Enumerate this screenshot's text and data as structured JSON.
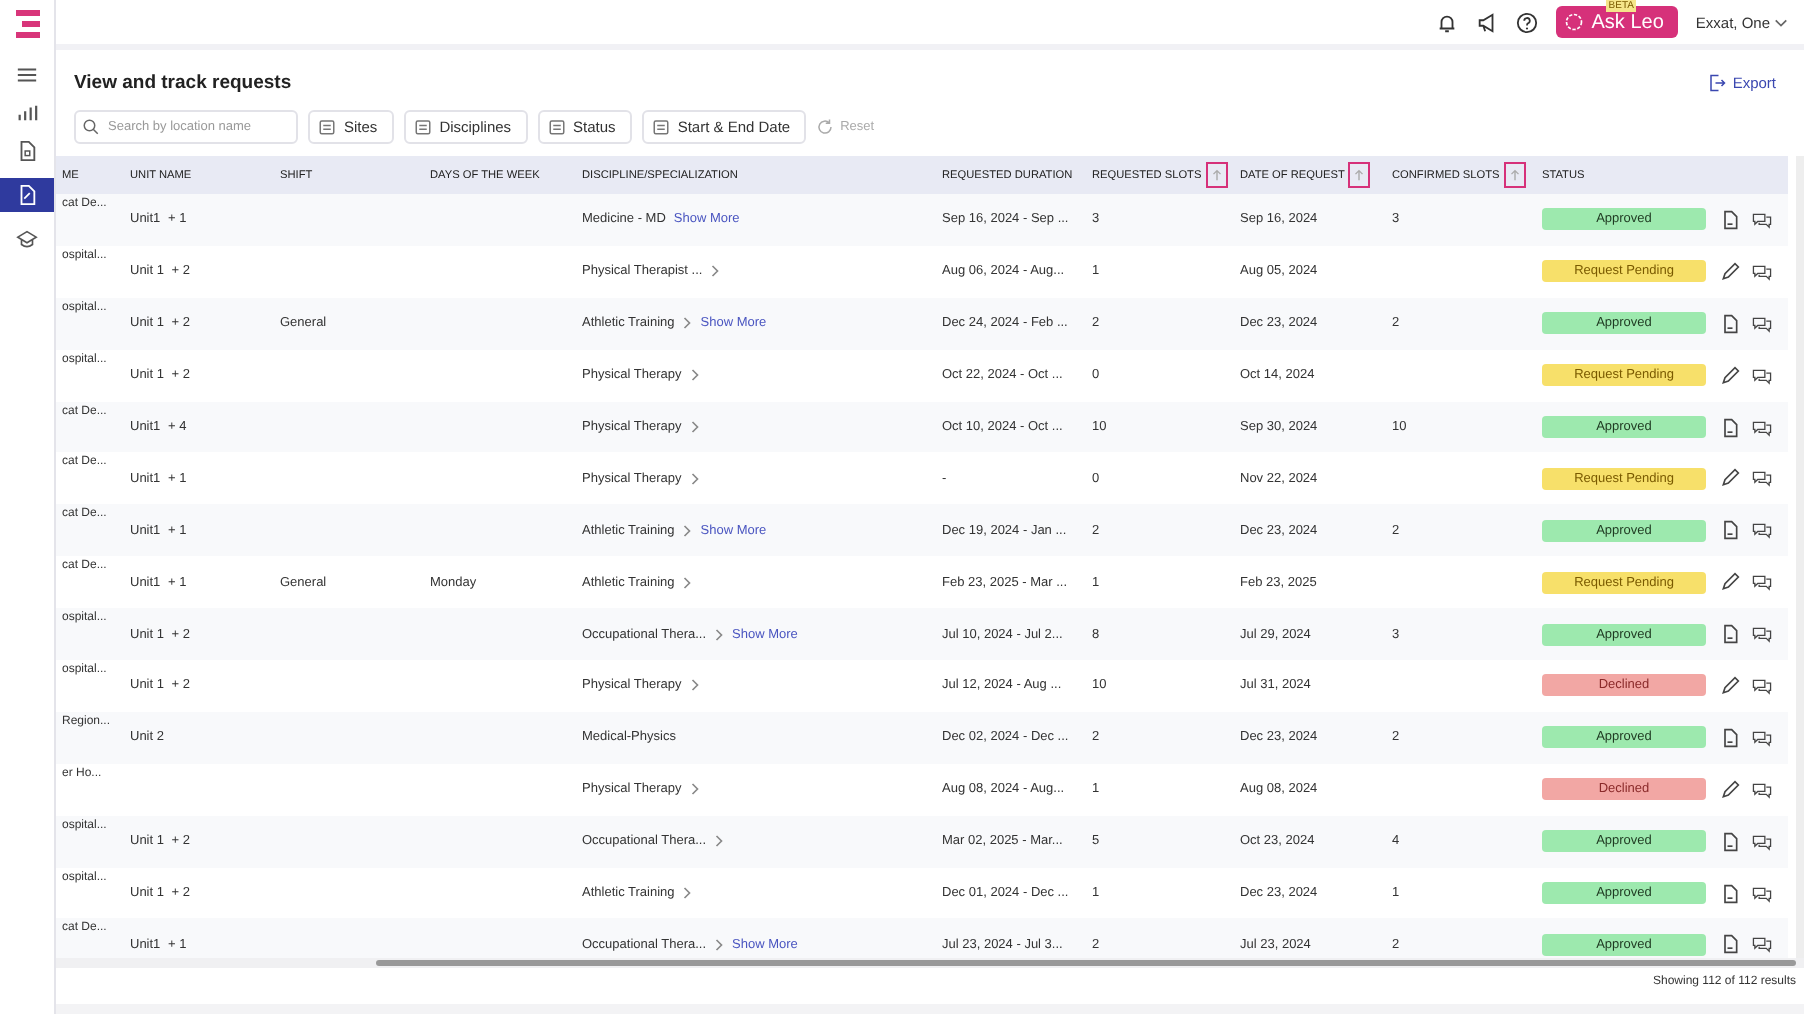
{
  "topbar": {
    "ask_button": "Ask Leo",
    "beta_badge": "BETA",
    "user": "Exxat, One"
  },
  "page": {
    "title": "View and track requests",
    "export": "Export"
  },
  "filters": {
    "search_placeholder": "Search by location name",
    "buttons": [
      "Sites",
      "Disciplines",
      "Status",
      "Start & End Date"
    ],
    "reset": "Reset"
  },
  "table": {
    "columns": [
      {
        "label": "ME",
        "sortable": false
      },
      {
        "label": "UNIT NAME",
        "sortable": false
      },
      {
        "label": "SHIFT",
        "sortable": false
      },
      {
        "label": "DAYS OF THE WEEK",
        "sortable": false
      },
      {
        "label": "DISCIPLINE/SPECIALIZATION",
        "sortable": false
      },
      {
        "label": "REQUESTED DURATION",
        "sortable": false
      },
      {
        "label": "REQUESTED SLOTS",
        "sortable": true
      },
      {
        "label": "DATE OF REQUEST",
        "sortable": true
      },
      {
        "label": "CONFIRMED SLOTS",
        "sortable": true
      },
      {
        "label": "STATUS",
        "sortable": false
      }
    ],
    "rows": [
      {
        "site": "cat De...",
        "unit": "Unit1",
        "extra": "+ 1",
        "shift": "",
        "days": "",
        "discipline": "Medicine - MD",
        "show_more": "Show More",
        "duration": "Sep 16, 2024  - Sep ...",
        "slots": "3",
        "date": "Sep 16, 2024",
        "confirmed": "3",
        "status": {
          "kind": "approved",
          "label": "Approved"
        }
      },
      {
        "site": "ospital...",
        "unit": "Unit 1",
        "extra": "+ 2",
        "shift": "",
        "days": "",
        "discipline": "Physical Therapist ...",
        "show_more": "",
        "duration": "Aug 06, 2024  - Aug...",
        "slots": "1",
        "date": "Aug 05, 2024",
        "confirmed": "",
        "status": {
          "kind": "pending",
          "label": "Request Pending"
        }
      },
      {
        "site": "ospital...",
        "unit": "Unit 1",
        "extra": "+ 2",
        "shift": "General",
        "days": "",
        "discipline": "Athletic Training",
        "show_more": "Show More",
        "duration": "Dec 24, 2024  - Feb ...",
        "slots": "2",
        "date": "Dec 23, 2024",
        "confirmed": "2",
        "status": {
          "kind": "approved",
          "label": "Approved"
        }
      },
      {
        "site": "ospital...",
        "unit": "Unit 1",
        "extra": "+ 2",
        "shift": "",
        "days": "",
        "discipline": "Physical Therapy",
        "show_more": "",
        "duration": "Oct 22, 2024  - Oct ...",
        "slots": "0",
        "date": "Oct 14, 2024",
        "confirmed": "",
        "status": {
          "kind": "pending",
          "label": "Request Pending"
        }
      },
      {
        "site": "cat De...",
        "unit": "Unit1",
        "extra": "+ 4",
        "shift": "",
        "days": "",
        "discipline": "Physical Therapy",
        "show_more": "",
        "duration": "Oct 10, 2024  - Oct ...",
        "slots": "10",
        "date": "Sep 30, 2024",
        "confirmed": "10",
        "status": {
          "kind": "approved",
          "label": "Approved"
        }
      },
      {
        "site": "cat De...",
        "unit": "Unit1",
        "extra": "+ 1",
        "shift": "",
        "days": "",
        "discipline": "Physical Therapy",
        "show_more": "",
        "duration": "-",
        "slots": "0",
        "date": "Nov 22, 2024",
        "confirmed": "",
        "status": {
          "kind": "pending",
          "label": "Request Pending"
        }
      },
      {
        "site": "cat De...",
        "unit": "Unit1",
        "extra": "+ 1",
        "shift": "",
        "days": "",
        "discipline": "Athletic Training",
        "show_more": "Show More",
        "duration": "Dec 19, 2024  - Jan ...",
        "slots": "2",
        "date": "Dec 23, 2024",
        "confirmed": "2",
        "status": {
          "kind": "approved",
          "label": "Approved"
        }
      },
      {
        "site": "cat De...",
        "unit": "Unit1",
        "extra": "+ 1",
        "shift": "General",
        "days": "Monday",
        "discipline": "Athletic Training",
        "show_more": "",
        "duration": "Feb 23, 2025  - Mar ...",
        "slots": "1",
        "date": "Feb 23, 2025",
        "confirmed": "",
        "status": {
          "kind": "pending",
          "label": "Request Pending"
        }
      },
      {
        "site": "ospital...",
        "unit": "Unit 1",
        "extra": "+ 2",
        "shift": "",
        "days": "",
        "discipline": "Occupational Thera...",
        "show_more": "Show More",
        "duration": "Jul 10, 2024  - Jul 2...",
        "slots": "8",
        "date": "Jul 29, 2024",
        "confirmed": "3",
        "status": {
          "kind": "approved",
          "label": "Approved"
        }
      },
      {
        "site": "ospital...",
        "unit": "Unit 1",
        "extra": "+ 2",
        "shift": "",
        "days": "",
        "discipline": "Physical Therapy",
        "show_more": "",
        "duration": "Jul 12, 2024  - Aug ...",
        "slots": "10",
        "date": "Jul 31, 2024",
        "confirmed": "",
        "status": {
          "kind": "declined",
          "label": "Declined"
        }
      },
      {
        "site": "Region...",
        "unit": "Unit 2",
        "extra": "",
        "shift": "",
        "days": "",
        "discipline": "Medical-Physics",
        "show_more": "",
        "duration": "Dec 02, 2024  - Dec ...",
        "slots": "2",
        "date": "Dec 23, 2024",
        "confirmed": "2",
        "status": {
          "kind": "approved",
          "label": "Approved"
        }
      },
      {
        "site": "er Ho...",
        "unit": "",
        "extra": "",
        "shift": "",
        "days": "",
        "discipline": "Physical Therapy",
        "show_more": "",
        "duration": "Aug 08, 2024  - Aug...",
        "slots": "1",
        "date": "Aug 08, 2024",
        "confirmed": "",
        "status": {
          "kind": "declined",
          "label": "Declined"
        }
      },
      {
        "site": "ospital...",
        "unit": "Unit 1",
        "extra": "+ 2",
        "shift": "",
        "days": "",
        "discipline": "Occupational Thera...",
        "show_more": "",
        "duration": "Mar 02, 2025  - Mar...",
        "slots": "5",
        "date": "Oct 23, 2024",
        "confirmed": "4",
        "status": {
          "kind": "approved",
          "label": "Approved"
        }
      },
      {
        "site": "ospital...",
        "unit": "Unit 1",
        "extra": "+ 2",
        "shift": "",
        "days": "",
        "discipline": "Athletic Training",
        "show_more": "",
        "duration": "Dec 01, 2024  - Dec ...",
        "slots": "1",
        "date": "Dec 23, 2024",
        "confirmed": "1",
        "status": {
          "kind": "approved",
          "label": "Approved"
        }
      },
      {
        "site": "cat De...",
        "unit": "Unit1",
        "extra": "+ 1",
        "shift": "",
        "days": "",
        "discipline": "Occupational Thera...",
        "show_more": "Show More",
        "duration": "Jul 23, 2024  - Jul 3...",
        "slots": "2",
        "date": "Jul 23, 2024",
        "confirmed": "2",
        "status": {
          "kind": "approved",
          "label": "Approved"
        }
      }
    ]
  },
  "footer": {
    "results": "Showing 112 of 112 results"
  }
}
